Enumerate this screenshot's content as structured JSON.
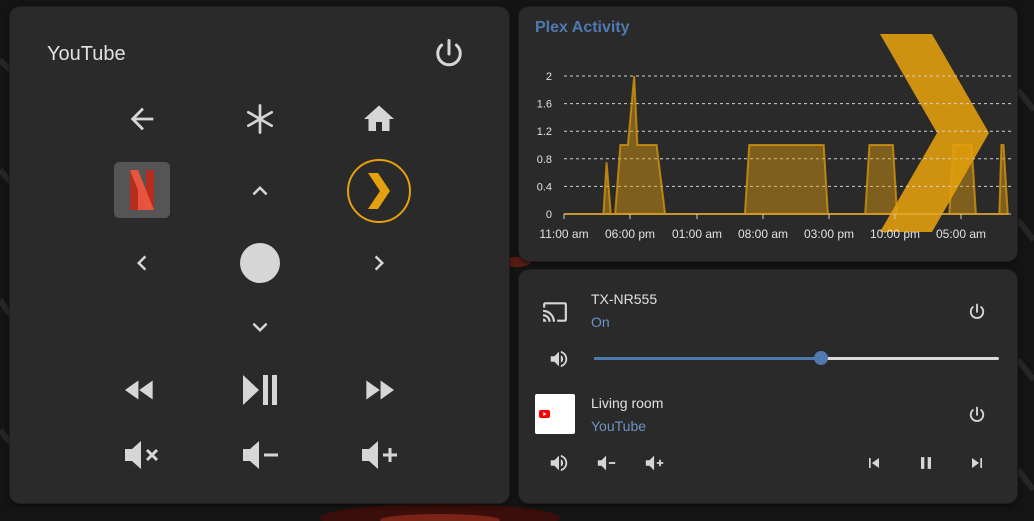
{
  "remote": {
    "title": "YouTube",
    "buttons": {
      "back": "arrow-left-icon",
      "menu": "asterisk-icon",
      "home": "home-icon",
      "netflix": "netflix-icon",
      "up": "chevron-up-icon",
      "plex": "plex-icon",
      "left": "chevron-left-icon",
      "select": "circle-icon",
      "right": "chevron-right-icon",
      "down": "chevron-down-icon",
      "rewind": "rewind-icon",
      "play_pause": "play-pause-icon",
      "fast_forward": "fast-forward-icon",
      "mute": "volume-mute-icon",
      "vol_down": "volume-minus-icon",
      "vol_up": "volume-plus-icon"
    }
  },
  "plex_activity": {
    "title": "Plex Activity"
  },
  "chart_data": {
    "type": "area",
    "title": "Plex Activity",
    "xlabel": "",
    "ylabel": "",
    "ylim": [
      0,
      2.2
    ],
    "yticks": [
      0,
      0.4,
      0.8,
      1.2,
      1.6,
      2
    ],
    "xtick_labels": [
      "11:00 am",
      "06:00 pm",
      "01:00 am",
      "08:00 am",
      "03:00 pm",
      "10:00 pm",
      "05:00 am"
    ],
    "series": [
      {
        "color": "#e5a00d",
        "x_hours": [
          0,
          3.3,
          3.7,
          4.0,
          4.4,
          4.8,
          5.3,
          5.6,
          6.0,
          6.6,
          6.9,
          7.4,
          8.3,
          8.7,
          9.5,
          10.0,
          10.6,
          11.0,
          17.0,
          17.4,
          18.0,
          24.4,
          24.8,
          28.3,
          28.7,
          29.0,
          30.9,
          31.3,
          36.2,
          36.6,
          37.0,
          38.3,
          38.7,
          40.9,
          41.1,
          41.3,
          41.7
        ],
        "values": [
          0,
          0,
          0,
          0.75,
          0,
          0,
          1.0,
          1.0,
          1.0,
          2.0,
          1.0,
          1.0,
          1.0,
          1.0,
          0,
          0,
          0,
          0,
          0,
          1.0,
          1.0,
          1.0,
          0,
          0,
          1.0,
          1.0,
          1.0,
          0,
          0,
          1.0,
          1.0,
          1.0,
          0,
          0,
          1.0,
          1.0,
          0
        ]
      }
    ]
  },
  "receiver": {
    "name": "TX-NR555",
    "state": "On",
    "volume_level": 0.56
  },
  "living_room": {
    "name": "Living room",
    "app": "YouTube",
    "thumb_label": "YouTube"
  },
  "colors": {
    "accent": "#4f7ab0",
    "plex_orange": "#e5a00d",
    "card_bg": "#2a2a2a"
  }
}
